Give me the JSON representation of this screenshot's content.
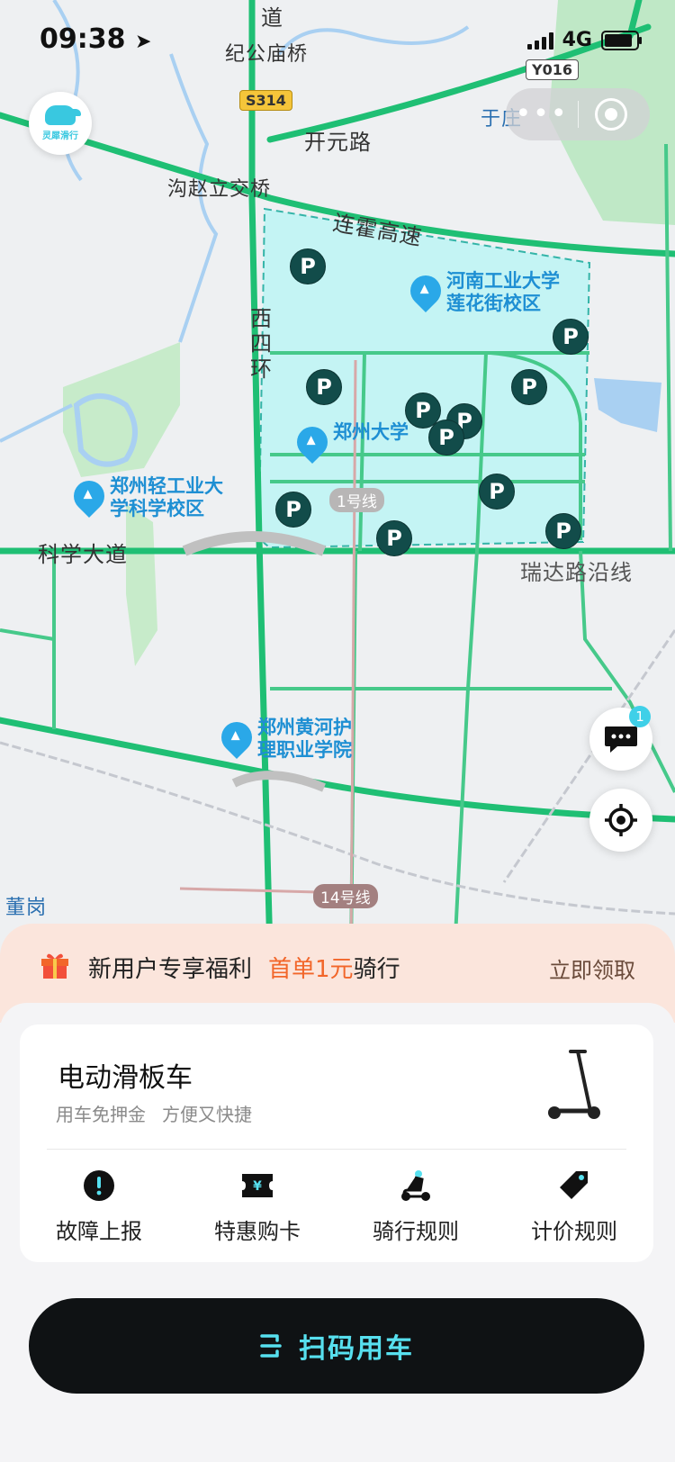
{
  "status_bar": {
    "time": "09:38",
    "network": "4G"
  },
  "map": {
    "labels": {
      "dao": "道",
      "jigongmiao": "纪公庙桥",
      "kaiyuan": "开元路",
      "yuzhuang": "于庄",
      "gouzhao": "沟赵立交桥",
      "lianhuo": "连霍高速",
      "xisi": "西四环",
      "kexue": "科学大道",
      "ruida": "瑞达路沿线",
      "donggang": "董岗"
    },
    "road_badges": {
      "s314": "S314",
      "y016": "Y016"
    },
    "metro_badges": {
      "line1": "1号线",
      "line14": "14号线"
    },
    "pois": {
      "hngy": "河南工业大学\n莲花街校区",
      "zzu": "郑州大学",
      "zzqg": "郑州轻工业大\n学科学校区",
      "zzhh": "郑州黄河护\n理职业学院"
    },
    "parking_symbol": "P",
    "message_badge": "1"
  },
  "app": {
    "logo_text": "灵犀滑行"
  },
  "promo": {
    "text": "新用户专享福利",
    "highlight": "首单1元",
    "suffix": "骑行",
    "claim": "立即领取"
  },
  "vehicle": {
    "title": "电动滑板车",
    "sub1": "用车免押金",
    "sub2": "方便又快捷"
  },
  "actions": [
    {
      "label": "故障上报",
      "icon": "alert-icon"
    },
    {
      "label": "特惠购卡",
      "icon": "ticket-icon"
    },
    {
      "label": "骑行规则",
      "icon": "scooter-icon"
    },
    {
      "label": "计价规则",
      "icon": "price-tag-icon"
    }
  ],
  "scan_button": {
    "label": "扫码用车"
  },
  "colors": {
    "accent": "#57e0ef",
    "promo_highlight": "#f2662a",
    "zone_fill": "#c4f4f4",
    "road": "#1fbf74"
  }
}
